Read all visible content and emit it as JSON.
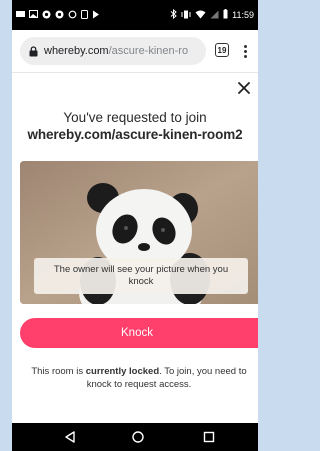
{
  "status_bar": {
    "time": "11:59",
    "left_icons": [
      "message-icon",
      "image-icon",
      "edge-icon",
      "edge-icon",
      "sync-icon",
      "phone-icon",
      "play-icon"
    ],
    "right_icons": [
      "bluetooth-icon",
      "vibrate-icon",
      "wifi-icon",
      "signal-icon",
      "battery-icon"
    ]
  },
  "browser": {
    "url_host": "whereby.com",
    "url_path": "/ascure-kinen-ro",
    "tab_count": "19"
  },
  "dialog": {
    "title_line1": "You've requested to join",
    "title_line2": "whereby.com/ascure-kinen-room2",
    "preview_caption": "The owner will see your picture when you knock",
    "knock_label": "Knock",
    "notice_before": "This room is ",
    "notice_bold": "currently locked",
    "notice_after": ". To join, you need to knock to request access."
  },
  "colors": {
    "accent": "#ff3f6c",
    "page_bg": "#c9dcef"
  }
}
